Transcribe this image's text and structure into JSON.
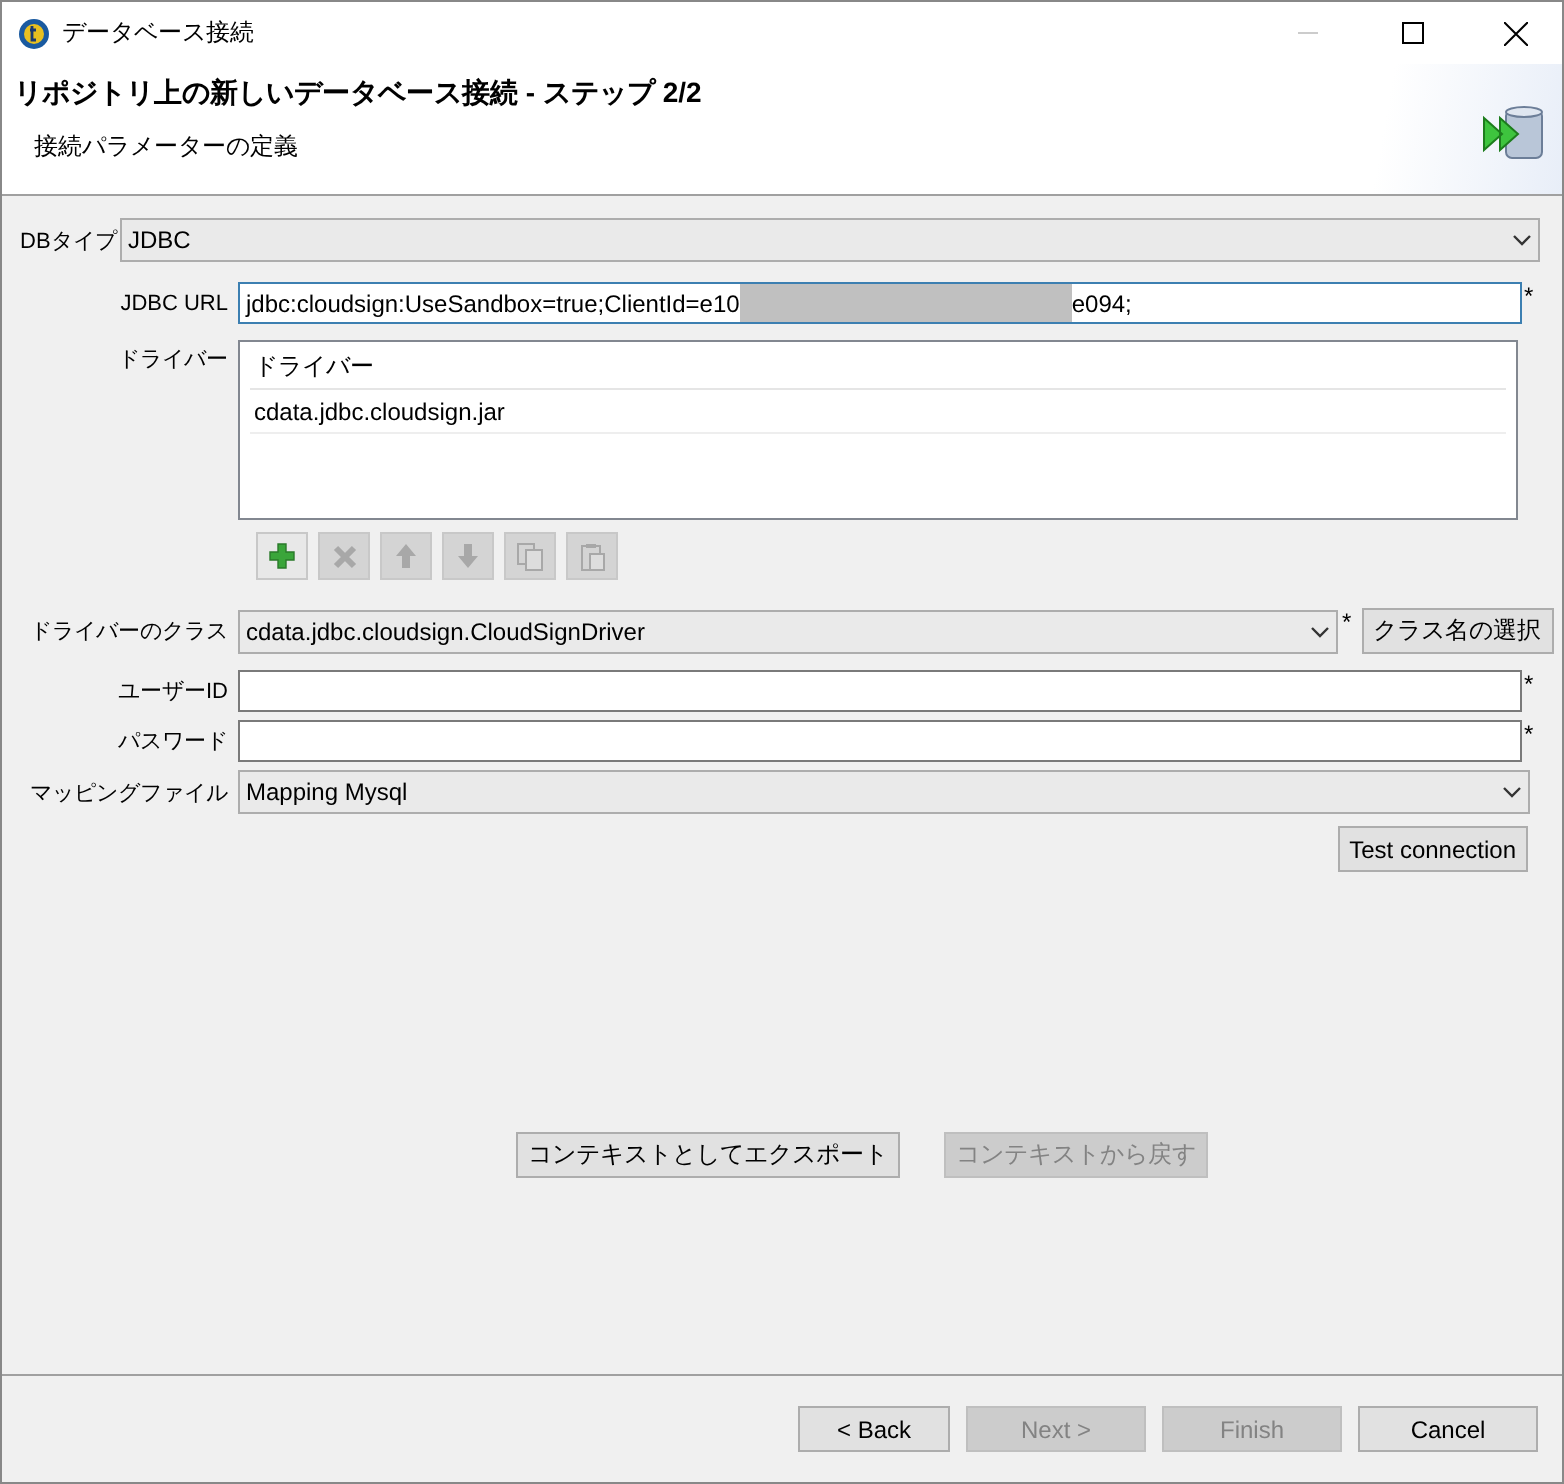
{
  "window": {
    "title": "データベース接続"
  },
  "header": {
    "title": "リポジトリ上の新しいデータベース接続 - ステップ 2/2",
    "subtitle": "接続パラメーターの定義"
  },
  "db_type": {
    "label": "DBタイプ",
    "value": "JDBC"
  },
  "jdbc_url": {
    "label": "JDBC URL",
    "value_start": "jdbc:cloudsign:UseSandbox=true;ClientId=e10",
    "value_end": "e094;",
    "required": "*"
  },
  "drivers": {
    "label": "ドライバー",
    "column": "ドライバー",
    "rows": [
      "cdata.jdbc.cloudsign.jar"
    ],
    "tools": [
      {
        "kind": "add",
        "disabled": false
      },
      {
        "kind": "delete",
        "disabled": true
      },
      {
        "kind": "up",
        "disabled": true
      },
      {
        "kind": "down",
        "disabled": true
      },
      {
        "kind": "copy",
        "disabled": true
      },
      {
        "kind": "paste",
        "disabled": true
      }
    ]
  },
  "driver_class": {
    "label": "ドライバーのクラス",
    "value": "cdata.jdbc.cloudsign.CloudSignDriver",
    "required": "*",
    "button": "クラス名の選択"
  },
  "user_id": {
    "label": "ユーザーID",
    "required": "*"
  },
  "password": {
    "label": "パスワード",
    "required": "*"
  },
  "mapping": {
    "label": "マッピングファイル",
    "value": "Mapping Mysql"
  },
  "test_button": "Test connection",
  "context_buttons": [
    {
      "label": "コンテキストとしてエクスポート",
      "disabled": false
    },
    {
      "label": "コンテキストから戻す",
      "disabled": true
    }
  ],
  "footer_buttons": [
    {
      "label": "< Back",
      "disabled": false
    },
    {
      "label": "Next >",
      "disabled": true
    },
    {
      "label": "Finish",
      "disabled": true
    },
    {
      "label": "Cancel",
      "disabled": false
    }
  ]
}
